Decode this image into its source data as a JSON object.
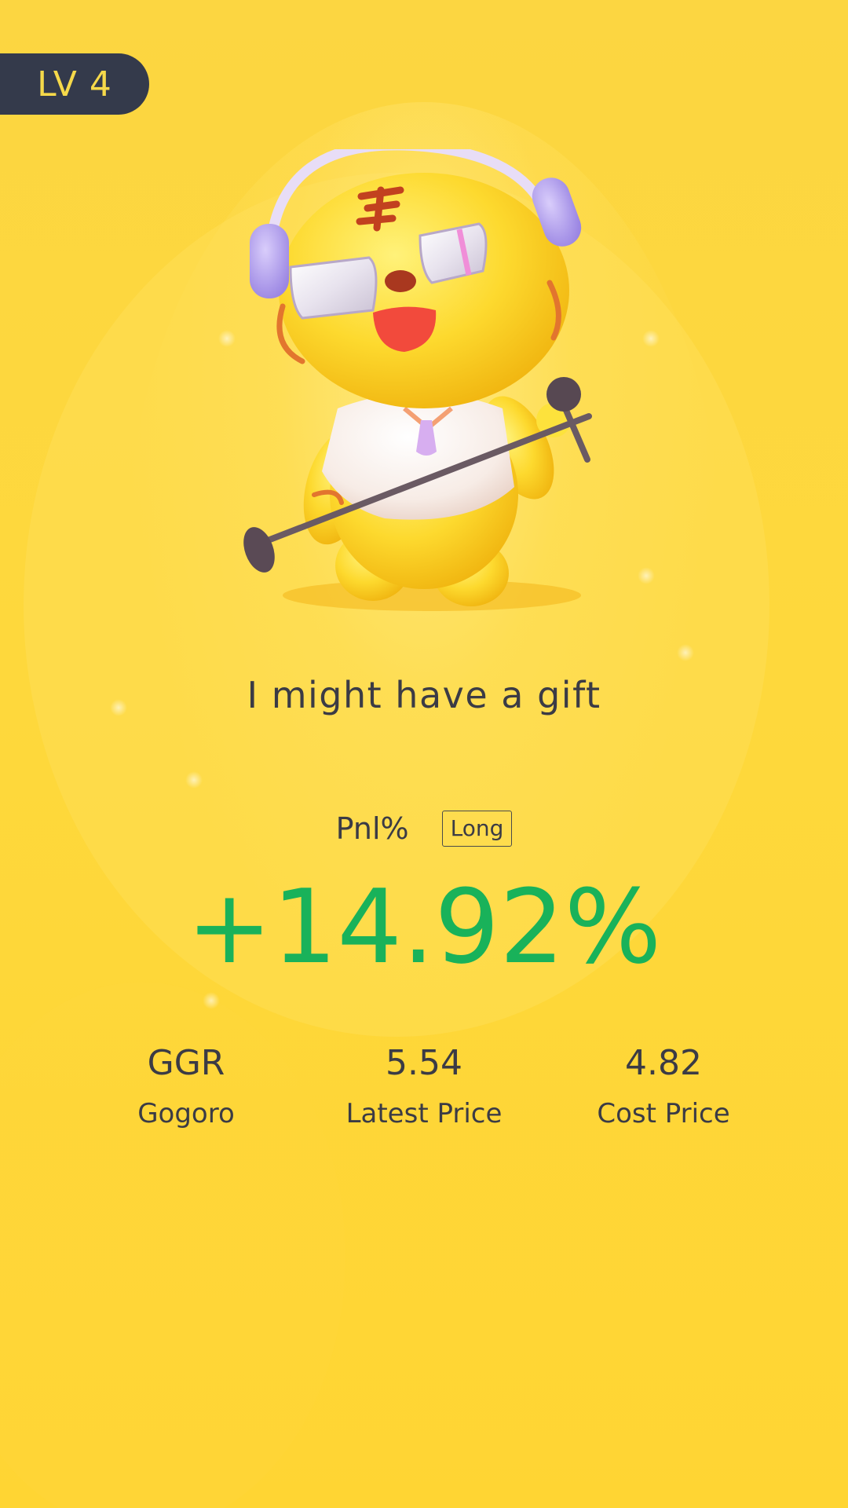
{
  "badge": {
    "level": "LV 4"
  },
  "mascot": {
    "icon": "tiger-mascot-with-headphones-and-microphone"
  },
  "caption": "I might have a gift",
  "pnl": {
    "label": "Pnl%",
    "position_type": "Long",
    "value": "+14.92%"
  },
  "stats": {
    "ticker": {
      "value": "GGR",
      "label": "Gogoro"
    },
    "latest_price": {
      "value": "5.54",
      "label": "Latest Price"
    },
    "cost_price": {
      "value": "4.82",
      "label": "Cost Price"
    }
  },
  "colors": {
    "background": "#fdd63e",
    "badge_bg": "#343a4b",
    "badge_text": "#f6d94a",
    "profit_green": "#19b25a",
    "text": "#3b3b45"
  }
}
